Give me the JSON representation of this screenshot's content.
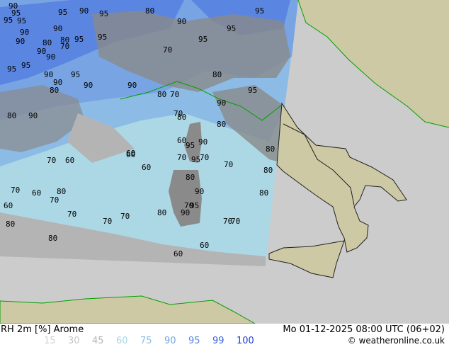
{
  "header": {
    "title": "RH 2m [%] Arome",
    "datetime": "Mo 01-12-2025 08:00 UTC (06+02)",
    "credit": "© weatheronline.co.uk"
  },
  "legend": [
    {
      "label": "15",
      "color": "#d2d2d2"
    },
    {
      "label": "30",
      "color": "#c4c4c4"
    },
    {
      "label": "45",
      "color": "#b4b4b4"
    },
    {
      "label": "60",
      "color": "#a8d4ea"
    },
    {
      "label": "75",
      "color": "#8cbce6"
    },
    {
      "label": "90",
      "color": "#78a4e4"
    },
    {
      "label": "95",
      "color": "#5a86e2"
    },
    {
      "label": "99",
      "color": "#3c64dc"
    },
    {
      "label": "100",
      "color": "#2040d0"
    }
  ],
  "colors": {
    "outside_domain": "#cccccc",
    "land": "#cdc9a5",
    "sea_rh": "#acd8e6",
    "coastline": "#00a000",
    "border": "#202020"
  },
  "contour_labels": [
    "90",
    "95",
    "95",
    "95",
    "90",
    "90",
    "95",
    "90",
    "95",
    "80",
    "80",
    "70",
    "95",
    "90",
    "90",
    "95",
    "95",
    "90",
    "95",
    "90",
    "80",
    "95",
    "90",
    "80",
    "70",
    "80",
    "70",
    "60",
    "90",
    "80",
    "90",
    "95",
    "95",
    "95",
    "70",
    "90",
    "60",
    "60",
    "70",
    "60",
    "80",
    "70",
    "70",
    "70",
    "80",
    "90",
    "95",
    "80",
    "90",
    "95",
    "95",
    "90",
    "80",
    "70",
    "70",
    "70",
    "80",
    "80",
    "80",
    "60",
    "60",
    "70",
    "60",
    "60",
    "80",
    "80",
    "90",
    "80",
    "70",
    "70",
    "60",
    "70",
    "80",
    "90",
    "95",
    "70"
  ]
}
